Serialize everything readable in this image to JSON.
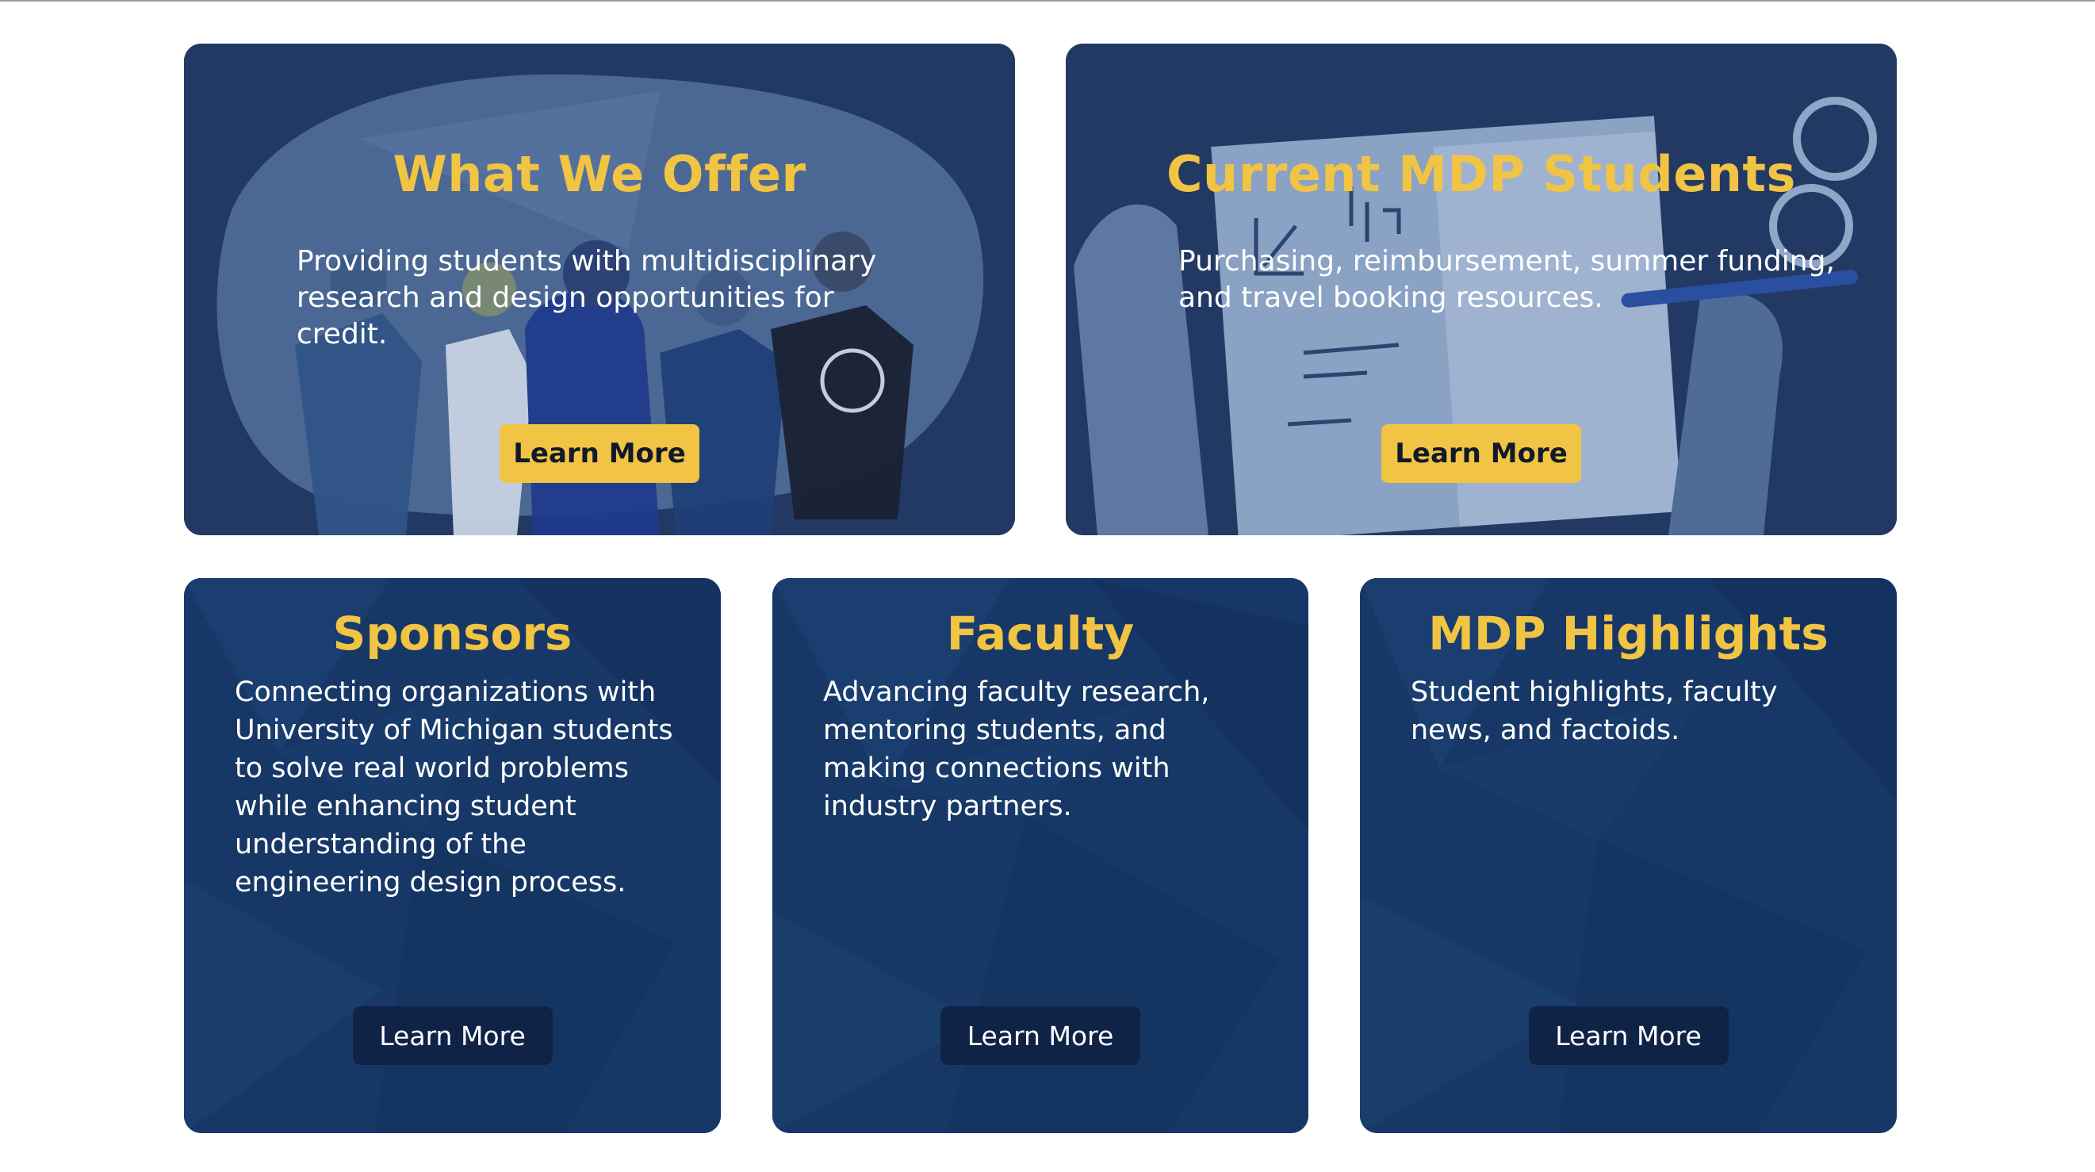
{
  "hero_cards": [
    {
      "title": "What We Offer",
      "text": "Providing students with multidisciplinary research and design opportunities for credit.",
      "button_label": "Learn More",
      "illustration": "students-group-illustration"
    },
    {
      "title": "Current MDP Students",
      "text": "Purchasing, reimbursement, summer funding, and travel booking resources.",
      "button_label": "Learn More",
      "illustration": "notebook-writing-illustration"
    }
  ],
  "tiles": [
    {
      "title": "Sponsors",
      "text": "Connecting organizations with University of Michigan students to solve real world problems while enhancing student understanding of the engineering design process.",
      "button_label": "Learn More"
    },
    {
      "title": "Faculty",
      "text": "Advancing faculty research, mentoring students, and making connections with industry partners.",
      "button_label": "Learn More"
    },
    {
      "title": "MDP Highlights",
      "text": "Student highlights, faculty news, and factoids.",
      "button_label": "Learn More"
    }
  ],
  "colors": {
    "accent_yellow": "#f2c443",
    "hero_bg": "#223a63",
    "tile_bg": "#173866",
    "tile_button": "#0f2347"
  }
}
